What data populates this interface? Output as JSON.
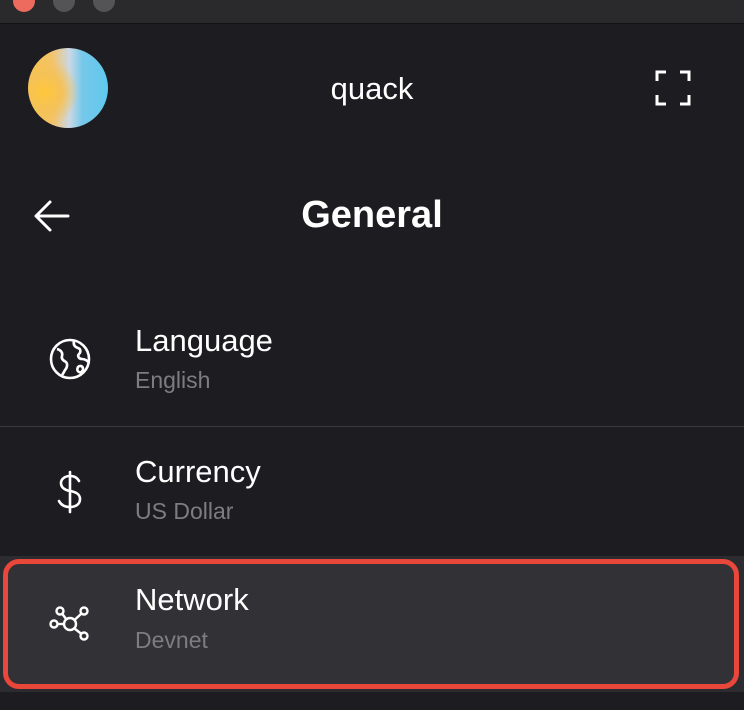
{
  "app": {
    "wallet_name": "quack"
  },
  "icons": {
    "avatar": "gradient-avatar",
    "expand": "expand-icon",
    "back": "arrow-left-icon",
    "language": "globe-icon",
    "currency": "dollar-icon",
    "network": "network-icon"
  },
  "page": {
    "title": "General"
  },
  "settings": [
    {
      "label": "Language",
      "value": "English"
    },
    {
      "label": "Currency",
      "value": "US Dollar"
    },
    {
      "label": "Network",
      "value": "Devnet"
    }
  ],
  "colors": {
    "background": "#1d1d21",
    "selected_row": "#323236",
    "highlight_border": "#e8473a",
    "secondary_text": "#7c7c82"
  }
}
